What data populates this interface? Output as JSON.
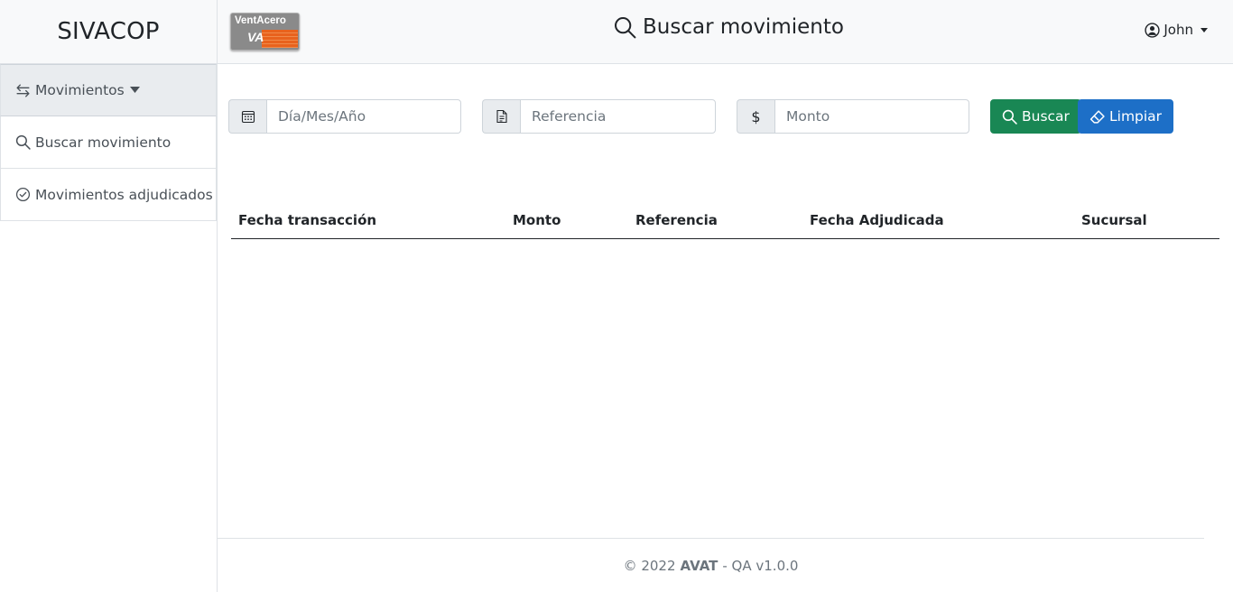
{
  "sidebar": {
    "brand": "SIVACOP",
    "group_label": "Movimientos",
    "items": [
      {
        "label": "Buscar movimiento",
        "icon": "search-icon"
      },
      {
        "label": "Movimientos adjudicados",
        "icon": "check-circle-icon"
      }
    ]
  },
  "header": {
    "logo_text_1": "Vent",
    "logo_text_2": "Acero",
    "logo_mark": "VA",
    "title": "Buscar movimiento",
    "user_name": "John"
  },
  "filters": {
    "date_placeholder": "Día/Mes/Año",
    "reference_placeholder": "Referencia",
    "amount_symbol": "$",
    "amount_placeholder": "Monto",
    "search_label": "Buscar",
    "clear_label": "Limpiar"
  },
  "table": {
    "columns": [
      "Fecha transacción",
      "Monto",
      "Referencia",
      "Fecha Adjudicada",
      "Sucursal"
    ],
    "rows": []
  },
  "footer": {
    "copyright": "© 2022",
    "company": "AVAT",
    "version": "- QA v1.0.0"
  },
  "colors": {
    "search_button": "#198754",
    "clear_button": "#1d6fc7",
    "logo_orange": "#e8621d"
  }
}
